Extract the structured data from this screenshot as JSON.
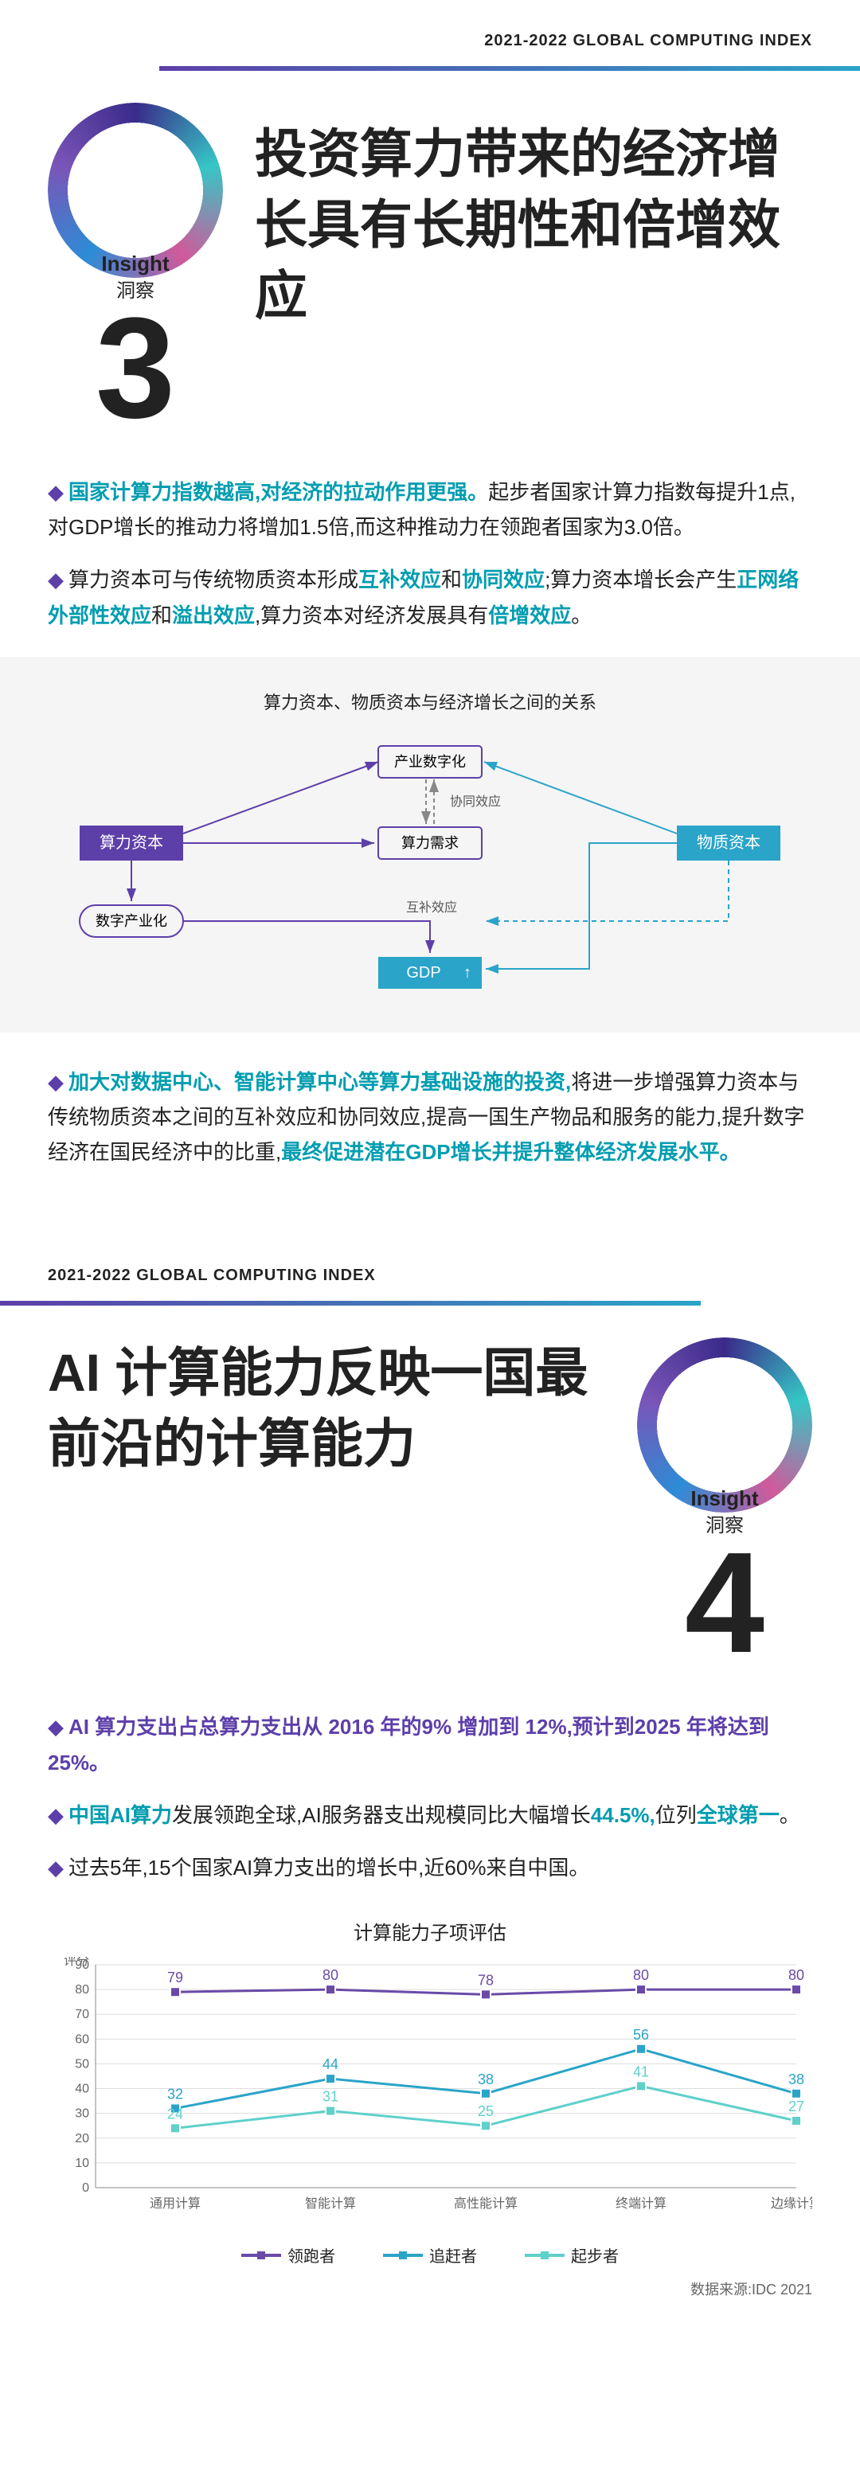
{
  "header_text": "2021-2022 GLOBAL COMPUTING INDEX",
  "insight3": {
    "label_en": "Insight",
    "label_cn": "洞察",
    "number": "3",
    "title": "投资算力带来的经济增长具有长期性和倍增效应",
    "paragraphs": [
      {
        "bullet": "◆",
        "hl": "国家计算力指数越高,对经济的拉动作用更强。",
        "rest": "起步者国家计算力指数每提升1点,对GDP增长的推动力将增加1.5倍,而这种推动力在领跑者国家为3.0倍。"
      },
      {
        "bullet": "◆",
        "parts": [
          {
            "t": "算力资本可与传统物质资本形成"
          },
          {
            "t": "互补效应",
            "cls": "hl-teal"
          },
          {
            "t": "和"
          },
          {
            "t": "协同效应",
            "cls": "hl-teal"
          },
          {
            "t": ";算力资本增长会产生"
          },
          {
            "t": "正网络外部性效应",
            "cls": "hl-teal"
          },
          {
            "t": "和"
          },
          {
            "t": "溢出效应",
            "cls": "hl-teal"
          },
          {
            "t": ",算力资本对经济发展具有"
          },
          {
            "t": "倍增效应",
            "cls": "hl-teal"
          },
          {
            "t": "。"
          }
        ]
      },
      {
        "bullet": "◆",
        "parts": [
          {
            "t": "加大对数据中心、智能计算中心等算力基础设施的投资,",
            "cls": "hl-teal"
          },
          {
            "t": "将进一步增强算力资本与传统物质资本之间的互补效应和协同效应,提高一国生产物品和服务的能力,提升数字经济在国民经济中的比重,"
          },
          {
            "t": "最终促进潜在GDP增长并提升整体经济发展水平。",
            "cls": "hl-teal"
          }
        ]
      }
    ],
    "diagram": {
      "title": "算力资本、物质资本与经济增长之间的关系",
      "n_compute": "算力资本",
      "n_material": "物质资本",
      "n_industry": "产业数字化",
      "n_demand": "算力需求",
      "n_digital": "数字产业化",
      "n_gdp": "GDP",
      "e_synergy": "协同效应",
      "e_complementary": "互补效应"
    }
  },
  "insight4": {
    "label_en": "Insight",
    "label_cn": "洞察",
    "number": "4",
    "title": "AI 计算能力反映一国最前沿的计算能力",
    "paragraphs": [
      {
        "bullet": "◆",
        "full_hl": "AI 算力支出占总算力支出从 2016 年的9% 增加到 12%,预计到2025 年将达到25%。",
        "cls": "hl-purple"
      },
      {
        "bullet": "◆",
        "parts": [
          {
            "t": "中国AI算力",
            "cls": "hl-teal"
          },
          {
            "t": "发展领跑全球,AI服务器支出规模同比大幅增长"
          },
          {
            "t": "44.5%,",
            "cls": "hl-teal"
          },
          {
            "t": "位列"
          },
          {
            "t": "全球第一",
            "cls": "hl-teal"
          },
          {
            "t": "。"
          }
        ]
      },
      {
        "bullet": "◆",
        "plain": "过去5年,15个国家AI算力支出的增长中,近60%来自中国。"
      }
    ]
  },
  "chart_data": {
    "type": "line",
    "title": "计算能力子项评估",
    "ylabel": "评分",
    "categories": [
      "通用计算",
      "智能计算",
      "高性能计算",
      "终端计算",
      "边缘计算"
    ],
    "ylim": [
      0,
      90
    ],
    "yticks": [
      0,
      10,
      20,
      30,
      40,
      50,
      60,
      70,
      80,
      90
    ],
    "series": [
      {
        "name": "领跑者",
        "values": [
          79,
          80,
          78,
          80,
          80
        ],
        "color": "#6a4aa8"
      },
      {
        "name": "追赶者",
        "values": [
          32,
          44,
          38,
          56,
          38
        ],
        "color": "#2aa4c8"
      },
      {
        "name": "起步者",
        "values": [
          24,
          31,
          25,
          41,
          27
        ],
        "color": "#5fd0ca"
      }
    ],
    "source": "数据来源:IDC 2021"
  }
}
